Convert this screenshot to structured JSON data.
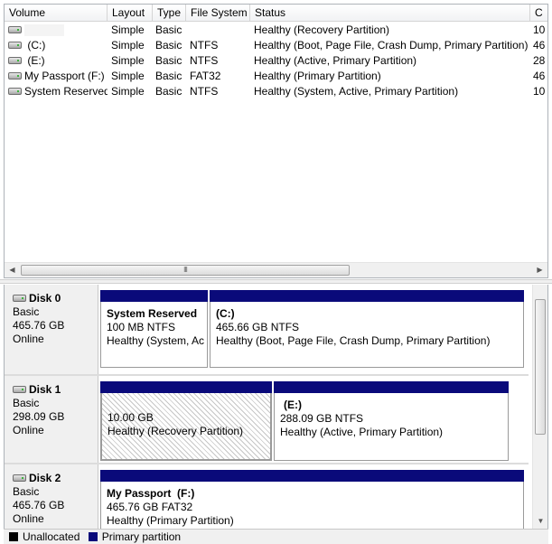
{
  "volume_list": {
    "columns": [
      "Volume",
      "Layout",
      "Type",
      "File System",
      "Status",
      "C"
    ],
    "rows": [
      {
        "volume": "",
        "layout": "Simple",
        "type": "Basic",
        "fs": "",
        "status": "Healthy (Recovery Partition)",
        "capacity": "10"
      },
      {
        "volume": "(C:)",
        "layout": "Simple",
        "type": "Basic",
        "fs": "NTFS",
        "status": "Healthy (Boot, Page File, Crash Dump, Primary Partition)",
        "capacity": "46"
      },
      {
        "volume": "(E:)",
        "layout": "Simple",
        "type": "Basic",
        "fs": "NTFS",
        "status": "Healthy (Active, Primary Partition)",
        "capacity": "28"
      },
      {
        "volume": "My Passport (F:)",
        "layout": "Simple",
        "type": "Basic",
        "fs": "FAT32",
        "status": "Healthy (Primary Partition)",
        "capacity": "46"
      },
      {
        "volume": "System Reserved",
        "layout": "Simple",
        "type": "Basic",
        "fs": "NTFS",
        "status": "Healthy (System, Active, Primary Partition)",
        "capacity": "10"
      }
    ],
    "scroll_thumb_glyph": "III"
  },
  "disks": [
    {
      "name": "Disk 0",
      "type": "Basic",
      "size": "465.76 GB",
      "state": "Online",
      "partitions": [
        {
          "title": "System Reserved",
          "size_fs": "100 MB NTFS",
          "status": "Healthy (System, Ac"
        },
        {
          "title": "(C:)",
          "size_fs": "465.66 GB NTFS",
          "status": "Healthy (Boot, Page File, Crash Dump, Primary Partition)"
        }
      ]
    },
    {
      "name": "Disk 1",
      "type": "Basic",
      "size": "298.09 GB",
      "state": "Online",
      "partitions": [
        {
          "title": "",
          "size_fs": "10.00 GB",
          "status": "Healthy (Recovery Partition)"
        },
        {
          "title": "(E:)",
          "size_fs": "288.09 GB NTFS",
          "status": "Healthy (Active, Primary Partition)"
        }
      ]
    },
    {
      "name": "Disk 2",
      "type": "Basic",
      "size": "465.76 GB",
      "state": "Online",
      "partitions": [
        {
          "title": "My Passport  (F:)",
          "size_fs": "465.76 GB FAT32",
          "status": "Healthy (Primary Partition)"
        }
      ]
    }
  ],
  "legend": {
    "unallocated": "Unallocated",
    "primary": "Primary partition",
    "unallocated_color": "#000000",
    "primary_color": "#0a0a7a"
  },
  "icons": {
    "drive": "drive-icon",
    "disk": "disk-icon"
  }
}
